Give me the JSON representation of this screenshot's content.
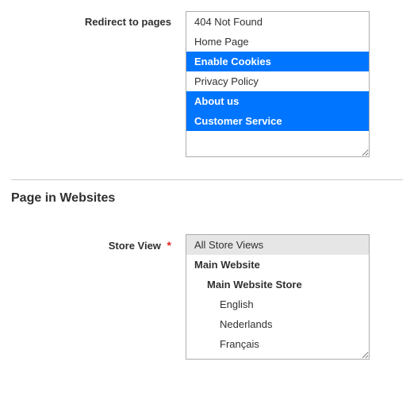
{
  "redirect": {
    "label": "Redirect to pages",
    "options": [
      {
        "label": "404 Not Found",
        "selected": false
      },
      {
        "label": "Home Page",
        "selected": false
      },
      {
        "label": "Enable Cookies",
        "selected": true
      },
      {
        "label": "Privacy Policy",
        "selected": false
      },
      {
        "label": "About us",
        "selected": true
      },
      {
        "label": "Customer Service",
        "selected": true
      }
    ]
  },
  "section": {
    "title": "Page in Websites"
  },
  "storeview": {
    "label": "Store View",
    "required_mark": "*",
    "options": [
      {
        "label": "All Store Views",
        "type": "all"
      },
      {
        "label": "Main Website",
        "type": "website"
      },
      {
        "label": "Main Website Store",
        "type": "store"
      },
      {
        "label": "English",
        "type": "view"
      },
      {
        "label": "Nederlands",
        "type": "view"
      },
      {
        "label": "Français",
        "type": "view"
      }
    ]
  }
}
